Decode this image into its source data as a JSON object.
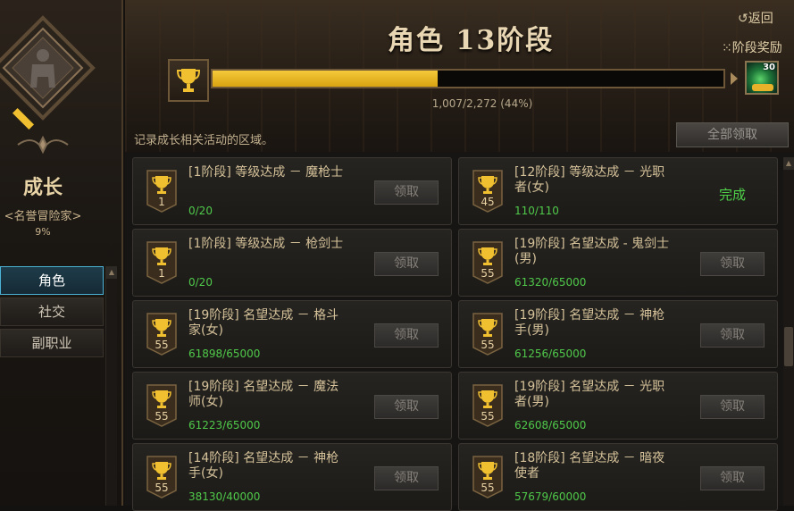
{
  "header": {
    "title": "角色 13阶段",
    "back_label": "返回",
    "back_arrow": "↺",
    "stage_reward_label": "阶段奖励",
    "stage_reward_glyph": "⁙",
    "progress_text": "1,007/2,272 (44%)",
    "progress_fraction": 0.44,
    "reward_count": "30",
    "description": "记录成长相关活动的区域。",
    "claim_all_label": "全部领取"
  },
  "sidebar": {
    "growth_title": "成长",
    "growth_subtitle": "<名誉冒险家>",
    "growth_percent": "9%",
    "items": [
      {
        "label": "角色",
        "active": true
      },
      {
        "label": "社交",
        "active": false
      },
      {
        "label": "副职业",
        "active": false
      }
    ]
  },
  "tasks": [
    {
      "name": "[1阶段] 等级达成 － 魔枪士",
      "progress": "0/20",
      "level": "1",
      "status": "领取",
      "completed": false
    },
    {
      "name": "[12阶段] 等级达成 － 光职者(女)",
      "progress": "110/110",
      "level": "45",
      "status": "完成",
      "completed": true
    },
    {
      "name": "[1阶段] 等级达成 － 枪剑士",
      "progress": "0/20",
      "level": "1",
      "status": "领取",
      "completed": false
    },
    {
      "name": "[19阶段] 名望达成 - 鬼剑士(男)",
      "progress": "61320/65000",
      "level": "55",
      "status": "领取",
      "completed": false
    },
    {
      "name": "[19阶段] 名望达成 － 格斗家(女)",
      "progress": "61898/65000",
      "level": "55",
      "status": "领取",
      "completed": false
    },
    {
      "name": "[19阶段] 名望达成 － 神枪手(男)",
      "progress": "61256/65000",
      "level": "55",
      "status": "领取",
      "completed": false
    },
    {
      "name": "[19阶段] 名望达成 － 魔法师(女)",
      "progress": "61223/65000",
      "level": "55",
      "status": "领取",
      "completed": false
    },
    {
      "name": "[19阶段] 名望达成 － 光职者(男)",
      "progress": "62608/65000",
      "level": "55",
      "status": "领取",
      "completed": false
    },
    {
      "name": "[14阶段] 名望达成 － 神枪手(女)",
      "progress": "38130/40000",
      "level": "55",
      "status": "领取",
      "completed": false
    },
    {
      "name": "[18阶段] 名望达成 － 暗夜使者",
      "progress": "57679/60000",
      "level": "55",
      "status": "领取",
      "completed": false
    }
  ],
  "colors": {
    "accent_gold": "#f0c030",
    "complete_green": "#4fd14a",
    "nav_active_border": "#4bb2d6"
  },
  "icons": {
    "trophy": "trophy-icon",
    "back": "return-arrow-icon",
    "gift": "gift-icon",
    "scroll_up": "scroll-up-arrow-icon",
    "scroll_down": "scroll-down-arrow-icon"
  }
}
